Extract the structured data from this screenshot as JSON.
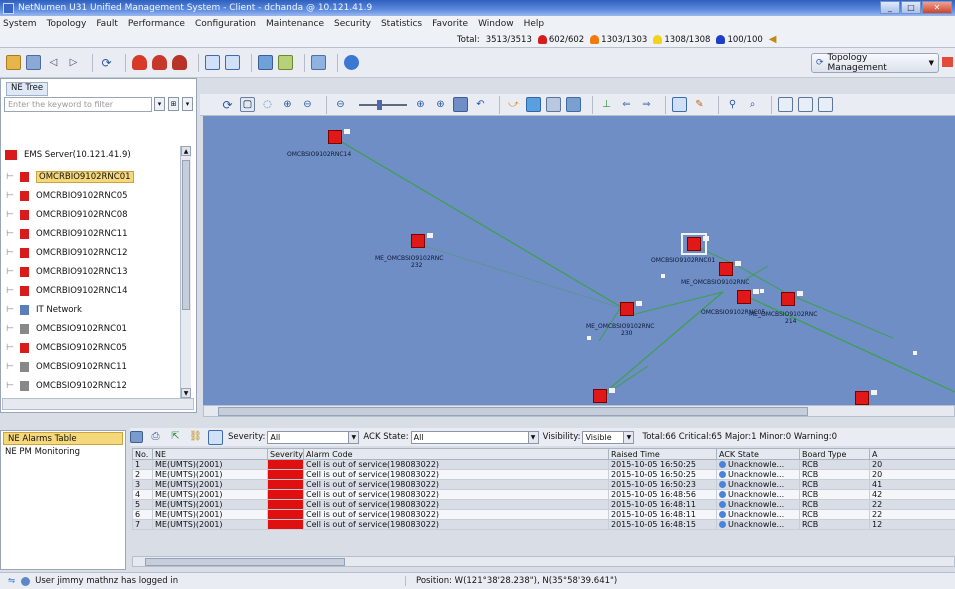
{
  "window": {
    "title": "NetNumen U31 Unified Management System - Client - dchanda @ 10.121.41.9",
    "controls": [
      "_",
      "□",
      "✕"
    ]
  },
  "menu": {
    "items": [
      "System",
      "Topology",
      "Fault",
      "Performance",
      "Configuration",
      "Maintenance",
      "Security",
      "Statistics",
      "Favorite",
      "Window",
      "Help"
    ]
  },
  "alarm_totals": {
    "total_label": "Total:",
    "total_value": "3513/3513",
    "critical": "602/602",
    "major": "1303/1303",
    "minor": "1308/1308",
    "warning": "100/100",
    "colors": {
      "critical": "#d81c1c",
      "major": "#f07a10",
      "minor": "#f2d21c",
      "warning": "#1c3fc8"
    }
  },
  "toolbar": {
    "view_dropdown": "Topology Management"
  },
  "ne_tree": {
    "tab_label": "NE Tree",
    "search_placeholder": "Enter the keyword to filter",
    "root_label": "EMS Server(10.121.41.9)",
    "items": [
      {
        "label": "OMCRBIO9102RNC01",
        "color": "#d81c1c",
        "selected": true
      },
      {
        "label": "OMCRBIO9102RNC05",
        "color": "#d81c1c",
        "selected": false
      },
      {
        "label": "OMCRBIO9102RNC08",
        "color": "#d81c1c",
        "selected": false
      },
      {
        "label": "OMCRBIO9102RNC11",
        "color": "#d81c1c",
        "selected": false
      },
      {
        "label": "OMCRBIO9102RNC12",
        "color": "#d81c1c",
        "selected": false
      },
      {
        "label": "OMCRBIO9102RNC13",
        "color": "#d81c1c",
        "selected": false
      },
      {
        "label": "OMCRBIO9102RNC14",
        "color": "#d81c1c",
        "selected": false
      },
      {
        "label": "IT Network",
        "color": "#5a7fb8",
        "selected": false
      },
      {
        "label": "OMCBSIO9102RNC01",
        "color": "#888888",
        "selected": false
      },
      {
        "label": "OMCBSIO9102RNC05",
        "color": "#d81c1c",
        "selected": false
      },
      {
        "label": "OMCBSIO9102RNC11",
        "color": "#888888",
        "selected": false
      },
      {
        "label": "OMCBSIO9102RNC12",
        "color": "#888888",
        "selected": false
      }
    ]
  },
  "map": {
    "nodes": [
      {
        "id": "n1",
        "label": "OMCBSIO9102RNC14"
      },
      {
        "id": "n2",
        "label": "ME_OMCBSIO9102RNC",
        "sub": "232"
      },
      {
        "id": "n3",
        "label": "OMCBSIO9102RNC01"
      },
      {
        "id": "n4",
        "label": "ME_OMCBSIO9102RNC"
      },
      {
        "id": "n5",
        "label": "OMCBSIO9102RNC05"
      },
      {
        "id": "n6",
        "label": "ME_OMCBSIO9102RNC",
        "sub": "214"
      },
      {
        "id": "n7",
        "label": "ME_OMCBSIO9102RNC",
        "sub": "230"
      }
    ]
  },
  "bottom_tabs": [
    "NE Alarms Table",
    "NE PM Monitoring"
  ],
  "alarm_filter": {
    "severity_label": "Severity:",
    "severity_value": "All",
    "ack_label": "ACK State:",
    "ack_value": "All",
    "visibility_label": "Visibility:",
    "visibility_value": "Visible",
    "summary": "Total:66 Critical:65 Major:1 Minor:0 Warning:0"
  },
  "alarm_table": {
    "columns": [
      "No.",
      "NE",
      "Severity",
      "Alarm Code",
      "Raised Time",
      "ACK State",
      "Board Type",
      "A"
    ],
    "rows": [
      {
        "no": "1",
        "ne": "ME(UMTS)(2001)",
        "sev": "Critical",
        "code": "Cell is out of service(198083022)",
        "time": "2015-10-05 16:50:25",
        "ack": "Unacknowle...",
        "board": "RCB",
        "a": "20"
      },
      {
        "no": "2",
        "ne": "ME(UMTS)(2001)",
        "sev": "Critical",
        "code": "Cell is out of service(198083022)",
        "time": "2015-10-05 16:50:25",
        "ack": "Unacknowle...",
        "board": "RCB",
        "a": "20"
      },
      {
        "no": "3",
        "ne": "ME(UMTS)(2001)",
        "sev": "Critical",
        "code": "Cell is out of service(198083022)",
        "time": "2015-10-05 16:50:23",
        "ack": "Unacknowle...",
        "board": "RCB",
        "a": "41"
      },
      {
        "no": "4",
        "ne": "ME(UMTS)(2001)",
        "sev": "Critical",
        "code": "Cell is out of service(198083022)",
        "time": "2015-10-05 16:48:56",
        "ack": "Unacknowle...",
        "board": "RCB",
        "a": "42"
      },
      {
        "no": "5",
        "ne": "ME(UMTS)(2001)",
        "sev": "Critical",
        "code": "Cell is out of service(198083022)",
        "time": "2015-10-05 16:48:11",
        "ack": "Unacknowle...",
        "board": "RCB",
        "a": "22"
      },
      {
        "no": "6",
        "ne": "ME(UMTS)(2001)",
        "sev": "Critical",
        "code": "Cell is out of service(198083022)",
        "time": "2015-10-05 16:48:11",
        "ack": "Unacknowle...",
        "board": "RCB",
        "a": "22"
      },
      {
        "no": "7",
        "ne": "ME(UMTS)(2001)",
        "sev": "Critical",
        "code": "Cell is out of service(198083022)",
        "time": "2015-10-05 16:48:15",
        "ack": "Unacknowle...",
        "board": "RCB",
        "a": "12"
      }
    ]
  },
  "status": {
    "message": "User jimmy mathnz has logged in",
    "position": "Position: W(121°38'28.238\"), N(35°58'39.641\")"
  }
}
